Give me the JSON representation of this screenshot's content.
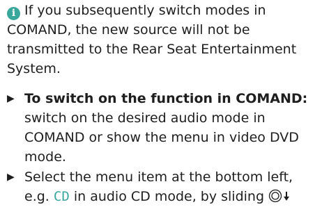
{
  "note": {
    "icon": "info-icon",
    "icon_glyph": "i",
    "icon_color": "#3aa79c",
    "text": "If you subsequently switch modes in COMAND, the new source will not be transmitted to the Rear Seat Entertainment System."
  },
  "steps": [
    {
      "bullet": "▶",
      "bold_text": "To switch on the function in COMAND:",
      "text": "switch on the desired audio mode in COMAND or show the menu in video DVD mode."
    },
    {
      "bullet": "▶",
      "text_before": "Select the menu item at the bottom left, e.g.",
      "highlight": "CD",
      "text_after": "in audio CD mode, by sliding",
      "controller_icon": "controller-slide-down-icon"
    }
  ]
}
